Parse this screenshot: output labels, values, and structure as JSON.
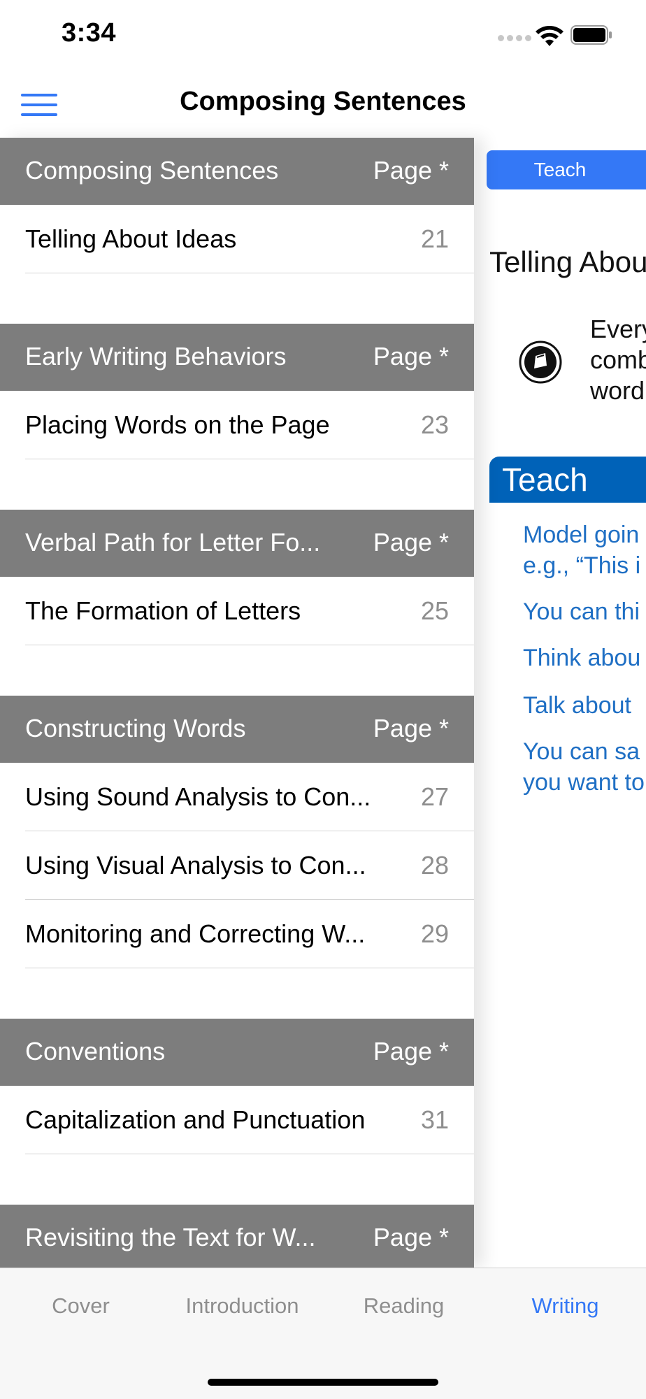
{
  "status": {
    "time": "3:34"
  },
  "nav": {
    "title": "Composing Sentences"
  },
  "toc": {
    "sections": [
      {
        "title": "Composing Sentences",
        "page_label": "Page *",
        "items": [
          {
            "label": "Telling About Ideas",
            "page": "21"
          }
        ]
      },
      {
        "title": "Early Writing Behaviors",
        "page_label": "Page *",
        "items": [
          {
            "label": "Placing Words on the Page",
            "page": "23"
          }
        ]
      },
      {
        "title": "Verbal Path for Letter Fo...",
        "page_label": "Page *",
        "items": [
          {
            "label": "The Formation of Letters",
            "page": "25"
          }
        ]
      },
      {
        "title": "Constructing Words",
        "page_label": "Page *",
        "items": [
          {
            "label": "Using Sound Analysis to Con...",
            "page": "27"
          },
          {
            "label": "Using Visual Analysis to Con...",
            "page": "28"
          },
          {
            "label": "Monitoring and Correcting W...",
            "page": "29"
          }
        ]
      },
      {
        "title": "Conventions",
        "page_label": "Page *",
        "items": [
          {
            "label": "Capitalization and Punctuation",
            "page": "31"
          }
        ]
      },
      {
        "title": "Revisiting the Text for W...",
        "page_label": "Page *",
        "items": []
      }
    ]
  },
  "detail": {
    "tab_label": "Teach",
    "heading": "Telling Abou",
    "intro_lines": [
      "Every",
      "comb",
      "word"
    ],
    "banner": "Teach",
    "bullets": [
      [
        "Model goin",
        "e.g., “This i"
      ],
      [
        "You can thi"
      ],
      [
        "Think abou"
      ],
      [
        "Talk about"
      ],
      [
        "You can sa",
        "you want to"
      ]
    ]
  },
  "tabbar": {
    "items": [
      {
        "label": "Cover",
        "active": false
      },
      {
        "label": "Introduction",
        "active": false
      },
      {
        "label": "Reading",
        "active": false
      },
      {
        "label": "Writing",
        "active": true
      }
    ]
  },
  "colors": {
    "accent": "#3478f6",
    "section_header": "#7d7d7d",
    "teach_banner": "#0062b8",
    "body_link": "#1f6fc4"
  }
}
